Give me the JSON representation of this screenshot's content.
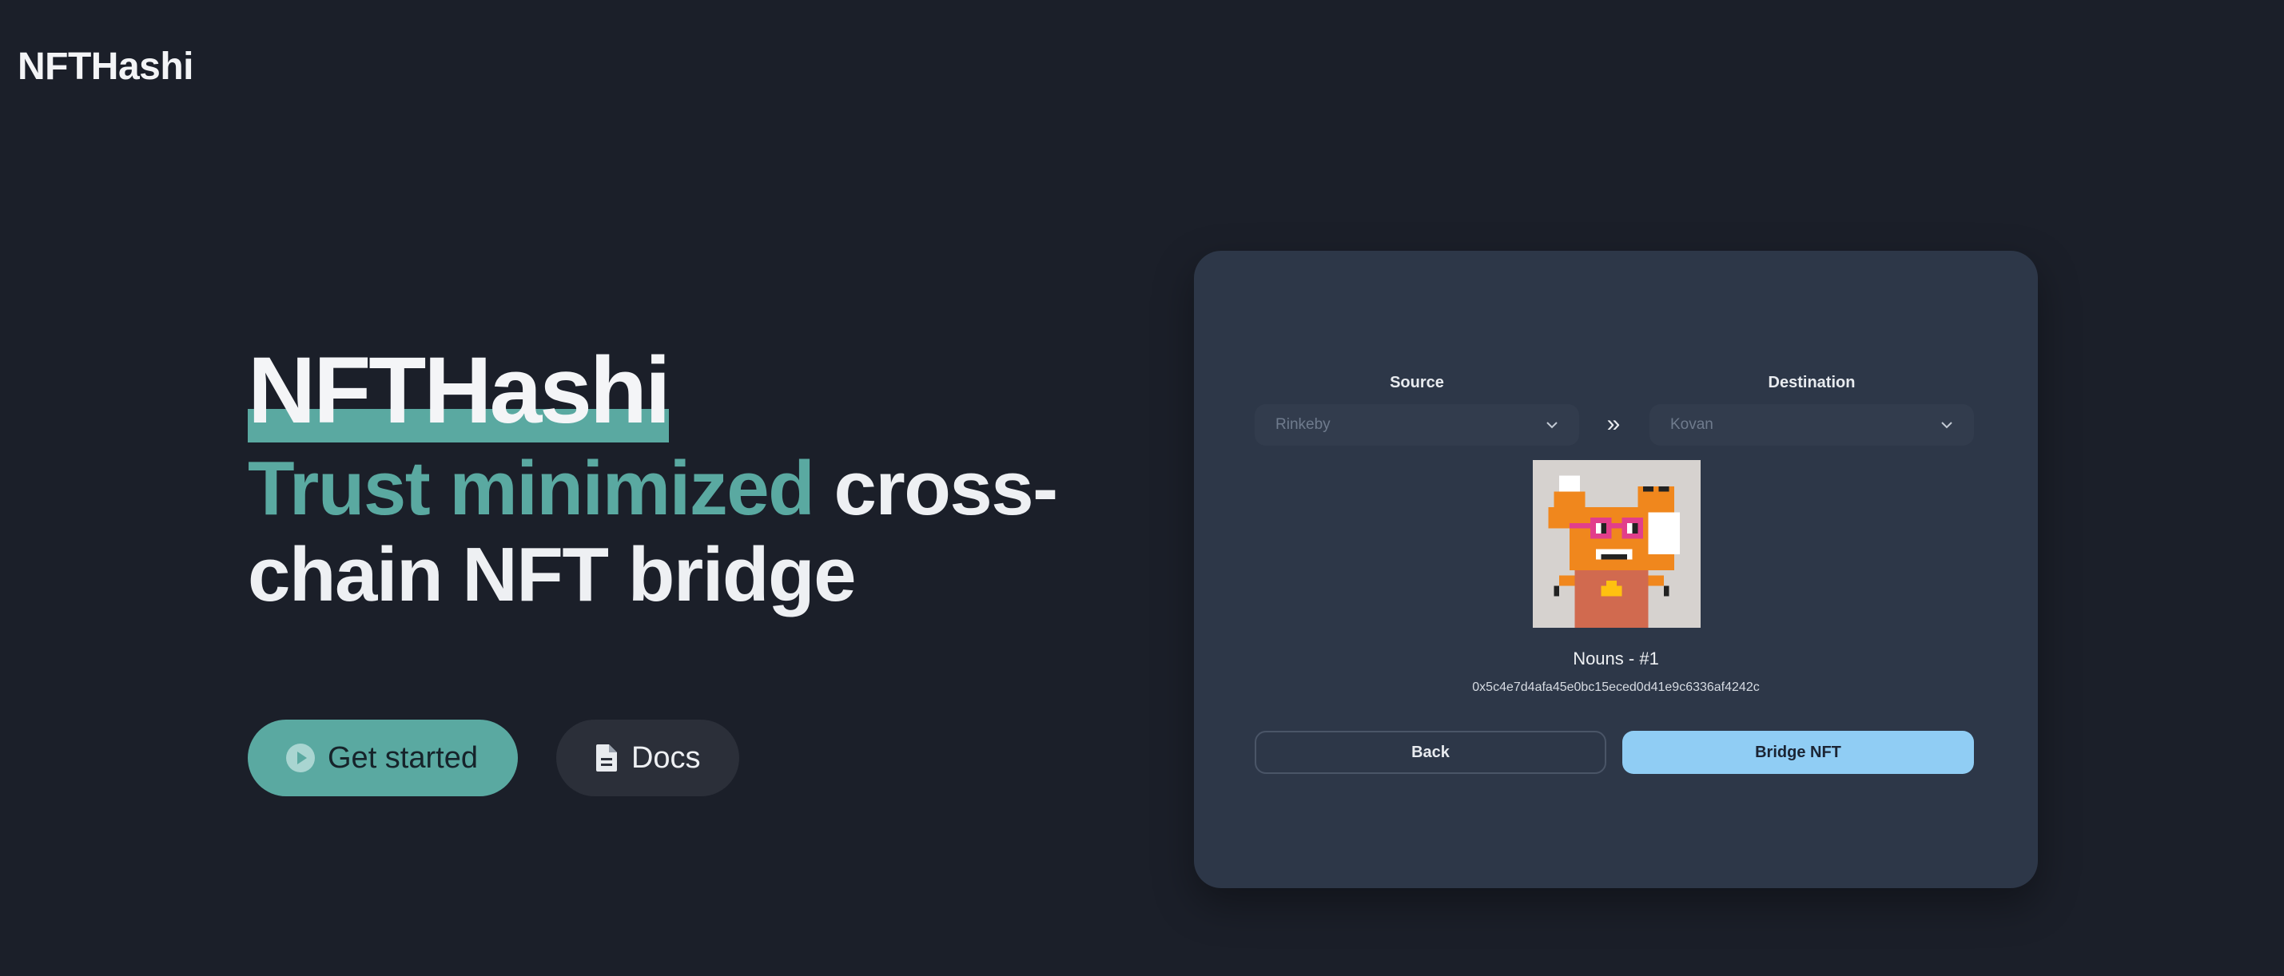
{
  "header": {
    "brand": "NFTHashi"
  },
  "hero": {
    "title": "NFTHashi",
    "subtitle_accent": "Trust minimized",
    "subtitle_rest": " cross-chain NFT bridge"
  },
  "cta": {
    "get_started_label": "Get started",
    "docs_label": "Docs"
  },
  "bridge_card": {
    "source_label": "Source",
    "destination_label": "Destination",
    "source_value": "Rinkeby",
    "destination_value": "Kovan",
    "arrow_glyph": "»",
    "nft_name": "Nouns - #1",
    "nft_address": "0x5c4e7d4afa45e0bc15eced0d41e9c6336af4242c",
    "back_label": "Back",
    "bridge_label": "Bridge NFT"
  },
  "colors": {
    "background": "#1b1f29",
    "accent_teal": "#5aa9a1",
    "card": "#2d3748",
    "primary_blue": "#90cdf4"
  },
  "icons": {
    "get_started": "play-circle-icon",
    "docs": "document-icon",
    "select_caret": "chevron-down-icon",
    "direction": "double-chevron-right-icon"
  }
}
